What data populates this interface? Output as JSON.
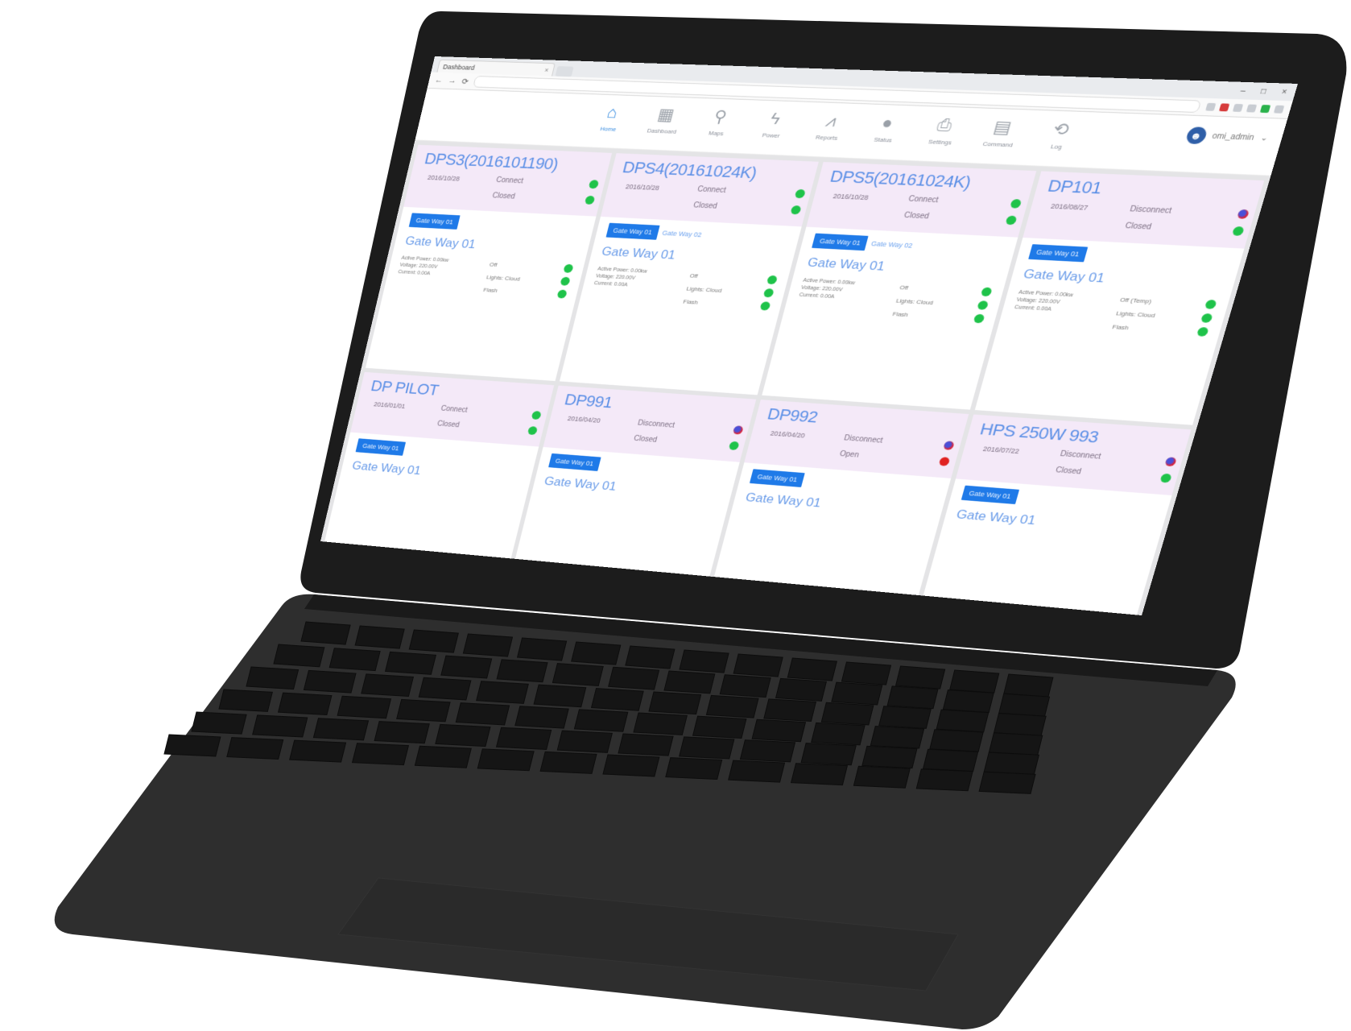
{
  "browser": {
    "tab_title": "Dashboard",
    "window_controls": [
      "–",
      "□",
      "×"
    ]
  },
  "nav": {
    "items": [
      {
        "label": "Home",
        "icon": "home-icon",
        "glyph": "⌂",
        "active": true
      },
      {
        "label": "Dashboard",
        "icon": "dashboard-icon",
        "glyph": "▦",
        "active": false
      },
      {
        "label": "Maps",
        "icon": "map-pin-icon",
        "glyph": "⚲",
        "active": false
      },
      {
        "label": "Power",
        "icon": "lightning-icon",
        "glyph": "ϟ",
        "active": false
      },
      {
        "label": "Reports",
        "icon": "chart-icon",
        "glyph": "⩘",
        "active": false
      },
      {
        "label": "Status",
        "icon": "globe-icon",
        "glyph": "●",
        "active": false
      },
      {
        "label": "Settings",
        "icon": "printer-icon",
        "glyph": "⎙",
        "active": false
      },
      {
        "label": "Command",
        "icon": "calendar-icon",
        "glyph": "▤",
        "active": false
      },
      {
        "label": "Log",
        "icon": "log-icon",
        "glyph": "⟲",
        "active": false
      }
    ],
    "user": {
      "name": "omi_admin",
      "avatar_icon": "user-avatar-icon"
    }
  },
  "devices": [
    {
      "name": "DPS3(2016101190)",
      "date": "2016/10/28",
      "status1": "Connect",
      "status2": "Closed",
      "dot1": "green",
      "dot2": "green",
      "gw_btn": "Gate Way 01",
      "gw_link": "",
      "gw_title": "Gate Way 01",
      "meta": [
        "Active Power: 0.00kw",
        "Voltage: 220.00V",
        "Current: 0.00A"
      ],
      "mrows": [
        {
          "label": "Off",
          "dot": "green"
        },
        {
          "label": "Lights: Cloud",
          "dot": "green"
        },
        {
          "label": "Flash",
          "dot": "green"
        }
      ]
    },
    {
      "name": "DPS4(20161024K)",
      "date": "2016/10/28",
      "status1": "Connect",
      "status2": "Closed",
      "dot1": "green",
      "dot2": "green",
      "gw_btn": "Gate Way 01",
      "gw_link": "Gate Way 02",
      "gw_title": "Gate Way 01",
      "meta": [
        "Active Power: 0.00kw",
        "Voltage: 220.00V",
        "Current: 0.00A"
      ],
      "mrows": [
        {
          "label": "Off",
          "dot": "green"
        },
        {
          "label": "Lights: Cloud",
          "dot": "green"
        },
        {
          "label": "Flash",
          "dot": "green"
        }
      ]
    },
    {
      "name": "DPS5(20161024K)",
      "date": "2016/10/28",
      "status1": "Connect",
      "status2": "Closed",
      "dot1": "green",
      "dot2": "green",
      "gw_btn": "Gate Way 01",
      "gw_link": "Gate Way 02",
      "gw_title": "Gate Way 01",
      "meta": [
        "Active Power: 0.00kw",
        "Voltage: 220.00V",
        "Current: 0.00A"
      ],
      "mrows": [
        {
          "label": "Off",
          "dot": "green"
        },
        {
          "label": "Lights: Cloud",
          "dot": "green"
        },
        {
          "label": "Flash",
          "dot": "green"
        }
      ]
    },
    {
      "name": "DP101",
      "date": "2016/08/27",
      "status1": "Disconnect",
      "status2": "Closed",
      "dot1": "redblue",
      "dot2": "green",
      "gw_btn": "Gate Way 01",
      "gw_link": "",
      "gw_title": "Gate Way 01",
      "meta": [
        "Active Power: 0.00kw",
        "Voltage: 220.00V",
        "Current: 0.00A"
      ],
      "mrows": [
        {
          "label": "Off (Temp)",
          "dot": "green"
        },
        {
          "label": "Lights: Cloud",
          "dot": "green"
        },
        {
          "label": "Flash",
          "dot": "green"
        }
      ]
    },
    {
      "name": "DP PILOT",
      "date": "2016/01/01",
      "status1": "Connect",
      "status2": "Closed",
      "dot1": "green",
      "dot2": "green",
      "gw_btn": "Gate Way 01",
      "gw_link": "",
      "gw_title": "Gate Way 01",
      "meta": [],
      "mrows": []
    },
    {
      "name": "DP991",
      "date": "2016/04/20",
      "status1": "Disconnect",
      "status2": "Closed",
      "dot1": "redblue",
      "dot2": "green",
      "gw_btn": "Gate Way 01",
      "gw_link": "",
      "gw_title": "Gate Way 01",
      "meta": [],
      "mrows": []
    },
    {
      "name": "DP992",
      "date": "2016/04/20",
      "status1": "Disconnect",
      "status2": "Open",
      "dot1": "redblue",
      "dot2": "red",
      "gw_btn": "Gate Way 01",
      "gw_link": "",
      "gw_title": "Gate Way 01",
      "meta": [],
      "mrows": []
    },
    {
      "name": "HPS 250W 993",
      "date": "2016/07/22",
      "status1": "Disconnect",
      "status2": "Closed",
      "dot1": "redblue",
      "dot2": "green",
      "gw_btn": "Gate Way 01",
      "gw_link": "",
      "gw_title": "Gate Way 01",
      "meta": [],
      "mrows": []
    }
  ],
  "colors": {
    "accent": "#1f7ae8",
    "device_name": "#5b8fe6",
    "card_header_bg": "#f4e9f8",
    "ok": "#1fc34a",
    "alarm": "#e02222",
    "laptop_body": "#2b2b2b"
  }
}
